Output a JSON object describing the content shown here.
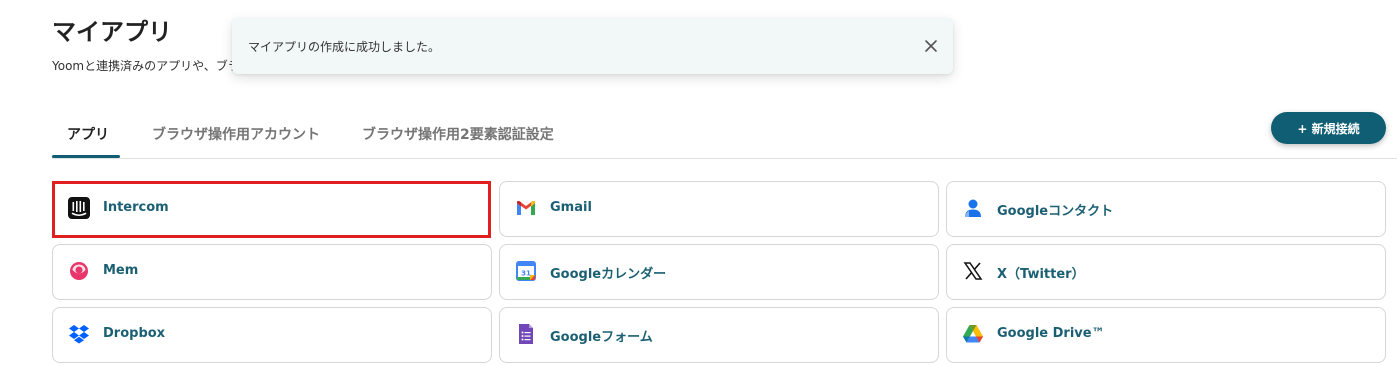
{
  "page": {
    "title": "マイアプリ",
    "subtitle": "Yoomと連携済みのアプリや、ブラ"
  },
  "toast": {
    "message": "マイアプリの作成に成功しました。",
    "close_icon": "close-icon"
  },
  "tabs": [
    {
      "label": "アプリ",
      "active": true
    },
    {
      "label": "ブラウザ操作用アカウント",
      "active": false
    },
    {
      "label": "ブラウザ操作用2要素認証設定",
      "active": false
    }
  ],
  "new_button": {
    "label": "+ 新規接続"
  },
  "apps": [
    {
      "label": "Intercom",
      "icon": "intercom-icon",
      "selected": true
    },
    {
      "label": "Gmail",
      "icon": "gmail-icon"
    },
    {
      "label": "Googleコンタクト",
      "icon": "google-contacts-icon"
    },
    {
      "label": "Mem",
      "icon": "mem-icon"
    },
    {
      "label": "Googleカレンダー",
      "icon": "google-calendar-icon"
    },
    {
      "label": "X（Twitter）",
      "icon": "x-twitter-icon"
    },
    {
      "label": "Dropbox",
      "icon": "dropbox-icon"
    },
    {
      "label": "Googleフォーム",
      "icon": "google-forms-icon"
    },
    {
      "label": "Google Drive™",
      "icon": "google-drive-icon"
    }
  ],
  "colors": {
    "accent": "#0f5e74",
    "selection_border": "#e02020",
    "app_label": "#1b5f73",
    "toast_bg": "#f2f8f7"
  }
}
